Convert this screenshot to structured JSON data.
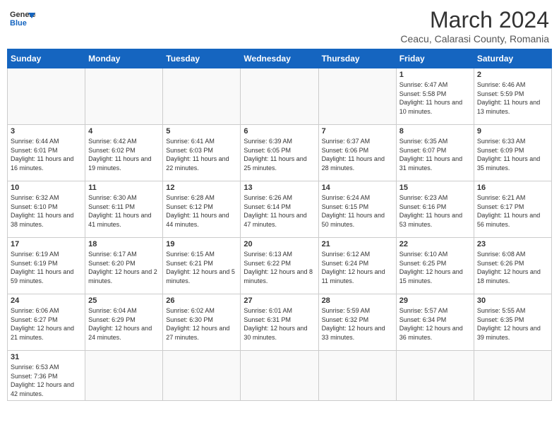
{
  "logo": {
    "text_general": "General",
    "text_blue": "Blue"
  },
  "header": {
    "title": "March 2024",
    "subtitle": "Ceacu, Calarasi County, Romania"
  },
  "weekdays": [
    "Sunday",
    "Monday",
    "Tuesday",
    "Wednesday",
    "Thursday",
    "Friday",
    "Saturday"
  ],
  "weeks": [
    [
      {
        "day": "",
        "info": ""
      },
      {
        "day": "",
        "info": ""
      },
      {
        "day": "",
        "info": ""
      },
      {
        "day": "",
        "info": ""
      },
      {
        "day": "",
        "info": ""
      },
      {
        "day": "1",
        "info": "Sunrise: 6:47 AM\nSunset: 5:58 PM\nDaylight: 11 hours and 10 minutes."
      },
      {
        "day": "2",
        "info": "Sunrise: 6:46 AM\nSunset: 5:59 PM\nDaylight: 11 hours and 13 minutes."
      }
    ],
    [
      {
        "day": "3",
        "info": "Sunrise: 6:44 AM\nSunset: 6:01 PM\nDaylight: 11 hours and 16 minutes."
      },
      {
        "day": "4",
        "info": "Sunrise: 6:42 AM\nSunset: 6:02 PM\nDaylight: 11 hours and 19 minutes."
      },
      {
        "day": "5",
        "info": "Sunrise: 6:41 AM\nSunset: 6:03 PM\nDaylight: 11 hours and 22 minutes."
      },
      {
        "day": "6",
        "info": "Sunrise: 6:39 AM\nSunset: 6:05 PM\nDaylight: 11 hours and 25 minutes."
      },
      {
        "day": "7",
        "info": "Sunrise: 6:37 AM\nSunset: 6:06 PM\nDaylight: 11 hours and 28 minutes."
      },
      {
        "day": "8",
        "info": "Sunrise: 6:35 AM\nSunset: 6:07 PM\nDaylight: 11 hours and 31 minutes."
      },
      {
        "day": "9",
        "info": "Sunrise: 6:33 AM\nSunset: 6:09 PM\nDaylight: 11 hours and 35 minutes."
      }
    ],
    [
      {
        "day": "10",
        "info": "Sunrise: 6:32 AM\nSunset: 6:10 PM\nDaylight: 11 hours and 38 minutes."
      },
      {
        "day": "11",
        "info": "Sunrise: 6:30 AM\nSunset: 6:11 PM\nDaylight: 11 hours and 41 minutes."
      },
      {
        "day": "12",
        "info": "Sunrise: 6:28 AM\nSunset: 6:12 PM\nDaylight: 11 hours and 44 minutes."
      },
      {
        "day": "13",
        "info": "Sunrise: 6:26 AM\nSunset: 6:14 PM\nDaylight: 11 hours and 47 minutes."
      },
      {
        "day": "14",
        "info": "Sunrise: 6:24 AM\nSunset: 6:15 PM\nDaylight: 11 hours and 50 minutes."
      },
      {
        "day": "15",
        "info": "Sunrise: 6:23 AM\nSunset: 6:16 PM\nDaylight: 11 hours and 53 minutes."
      },
      {
        "day": "16",
        "info": "Sunrise: 6:21 AM\nSunset: 6:17 PM\nDaylight: 11 hours and 56 minutes."
      }
    ],
    [
      {
        "day": "17",
        "info": "Sunrise: 6:19 AM\nSunset: 6:19 PM\nDaylight: 11 hours and 59 minutes."
      },
      {
        "day": "18",
        "info": "Sunrise: 6:17 AM\nSunset: 6:20 PM\nDaylight: 12 hours and 2 minutes."
      },
      {
        "day": "19",
        "info": "Sunrise: 6:15 AM\nSunset: 6:21 PM\nDaylight: 12 hours and 5 minutes."
      },
      {
        "day": "20",
        "info": "Sunrise: 6:13 AM\nSunset: 6:22 PM\nDaylight: 12 hours and 8 minutes."
      },
      {
        "day": "21",
        "info": "Sunrise: 6:12 AM\nSunset: 6:24 PM\nDaylight: 12 hours and 11 minutes."
      },
      {
        "day": "22",
        "info": "Sunrise: 6:10 AM\nSunset: 6:25 PM\nDaylight: 12 hours and 15 minutes."
      },
      {
        "day": "23",
        "info": "Sunrise: 6:08 AM\nSunset: 6:26 PM\nDaylight: 12 hours and 18 minutes."
      }
    ],
    [
      {
        "day": "24",
        "info": "Sunrise: 6:06 AM\nSunset: 6:27 PM\nDaylight: 12 hours and 21 minutes."
      },
      {
        "day": "25",
        "info": "Sunrise: 6:04 AM\nSunset: 6:29 PM\nDaylight: 12 hours and 24 minutes."
      },
      {
        "day": "26",
        "info": "Sunrise: 6:02 AM\nSunset: 6:30 PM\nDaylight: 12 hours and 27 minutes."
      },
      {
        "day": "27",
        "info": "Sunrise: 6:01 AM\nSunset: 6:31 PM\nDaylight: 12 hours and 30 minutes."
      },
      {
        "day": "28",
        "info": "Sunrise: 5:59 AM\nSunset: 6:32 PM\nDaylight: 12 hours and 33 minutes."
      },
      {
        "day": "29",
        "info": "Sunrise: 5:57 AM\nSunset: 6:34 PM\nDaylight: 12 hours and 36 minutes."
      },
      {
        "day": "30",
        "info": "Sunrise: 5:55 AM\nSunset: 6:35 PM\nDaylight: 12 hours and 39 minutes."
      }
    ],
    [
      {
        "day": "31",
        "info": "Sunrise: 6:53 AM\nSunset: 7:36 PM\nDaylight: 12 hours and 42 minutes."
      },
      {
        "day": "",
        "info": ""
      },
      {
        "day": "",
        "info": ""
      },
      {
        "day": "",
        "info": ""
      },
      {
        "day": "",
        "info": ""
      },
      {
        "day": "",
        "info": ""
      },
      {
        "day": "",
        "info": ""
      }
    ]
  ]
}
